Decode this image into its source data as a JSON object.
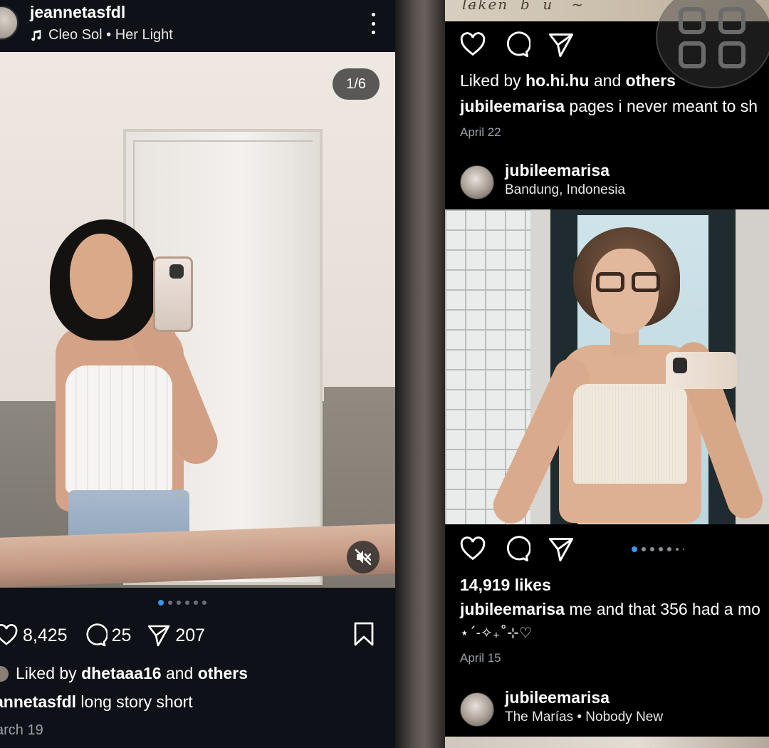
{
  "left_post": {
    "username": "jeannetasfdl",
    "music": "Cleo Sol • Her Light",
    "counter": "1/6",
    "likes": "8,425",
    "comments": "25",
    "shares": "207",
    "liked_prefix": "Liked by",
    "liked_user": "dhetaaa16",
    "liked_and": "and",
    "liked_others": "others",
    "caption_user": "annetasfdl",
    "caption_text": "long story short",
    "date": "arch 19",
    "carousel_count": 6,
    "carousel_active": 0
  },
  "right_feed": {
    "post1": {
      "liked_prefix": "Liked by",
      "liked_user": "ho.hi.hu",
      "liked_and": "and",
      "liked_others": "others",
      "caption_user": "jubileemarisa",
      "caption_text": "pages i never meant to sh",
      "date": "April 22"
    },
    "post2": {
      "username": "jubileemarisa",
      "location": "Bandung, Indonesia",
      "likes": "14,919 likes",
      "caption_user": "jubileemarisa",
      "caption_text": "me and that 356 had a mo",
      "caption_line2": "⋆ˊ˗✧₊˚⊹♡",
      "date": "April 15"
    },
    "post3": {
      "username": "jubileemarisa",
      "music": "The Marías • Nobody New"
    }
  },
  "colors": {
    "accent_blue": "#3897f0",
    "left_bg": "#0e1117",
    "right_bg": "#000000",
    "muted_text": "#9aa0a6"
  },
  "icons": [
    "music-note-icon",
    "more-icon",
    "mute-icon",
    "heart-icon",
    "comment-icon",
    "share-icon",
    "bookmark-icon",
    "grid-icon"
  ]
}
